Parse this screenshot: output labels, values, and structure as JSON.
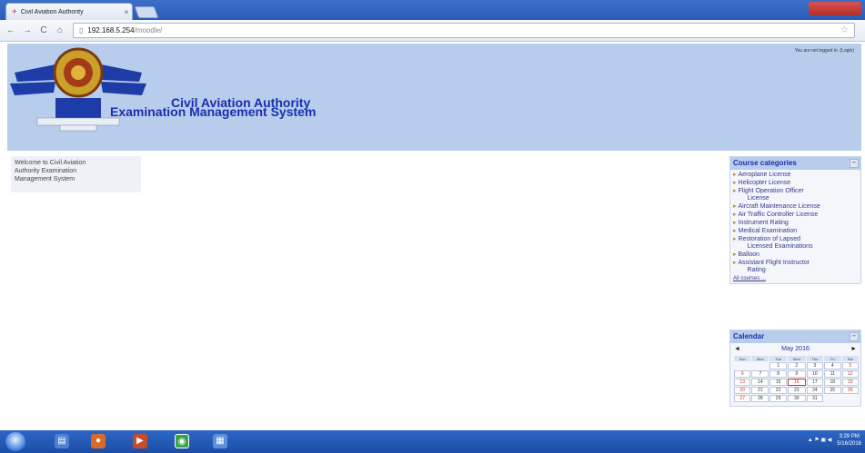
{
  "browser": {
    "tab_title": "Civil Aviation Authority",
    "tab_close": "×",
    "window_buttons": "",
    "back_icon": "back-arrow-icon",
    "url_host": "192.168.5.254",
    "url_path": "/moodle/"
  },
  "header": {
    "title_line1": "Civil Aviation Authority",
    "title_line2": "Examination Management System",
    "login_info": "You are not logged in. (Login)"
  },
  "welcome": {
    "line1": "Welcome to Civil Aviation",
    "line2": "Authority Examination",
    "line3": "Management System"
  },
  "course_categories": {
    "title": "Course categories",
    "items": [
      {
        "label": "Aeroplane License"
      },
      {
        "label": "Helicopter License"
      },
      {
        "label": "Flight Operation Officer",
        "label2": "License"
      },
      {
        "label": "Aircraft Maintenance License"
      },
      {
        "label": "Air Traffic Controller License"
      },
      {
        "label": "Instrument Rating"
      },
      {
        "label": "Medical Examination"
      },
      {
        "label": "Restoration of Lapsed",
        "label2": "Licensed Examinations"
      },
      {
        "label": "Balloon"
      },
      {
        "label": "Assistant Flight Instructor",
        "label2": "Rating"
      }
    ],
    "all_courses": "All courses ..."
  },
  "calendar": {
    "title": "Calendar",
    "prev": "◄",
    "next": "►",
    "month": "May 2016",
    "weekdays": [
      "Sun",
      "Mon",
      "Tue",
      "Wed",
      "Thu",
      "Fri",
      "Sat"
    ],
    "weeks": [
      [
        "",
        "",
        "1",
        "2",
        "3",
        "4",
        "5"
      ],
      [
        "6",
        "7",
        "8",
        "9",
        "10",
        "11",
        "12"
      ],
      [
        "13",
        "14",
        "15",
        "16",
        "17",
        "18",
        "19"
      ],
      [
        "20",
        "21",
        "22",
        "23",
        "24",
        "25",
        "26"
      ],
      [
        "27",
        "28",
        "29",
        "30",
        "31",
        "",
        ""
      ]
    ],
    "today": "16"
  },
  "taskbar": {
    "time": "3:29 PM",
    "date": "5/16/2016"
  },
  "colors": {
    "header_bg": "#b8cceb",
    "title_blue": "#1a2fb0",
    "taskbar": "#1b4ea6"
  }
}
